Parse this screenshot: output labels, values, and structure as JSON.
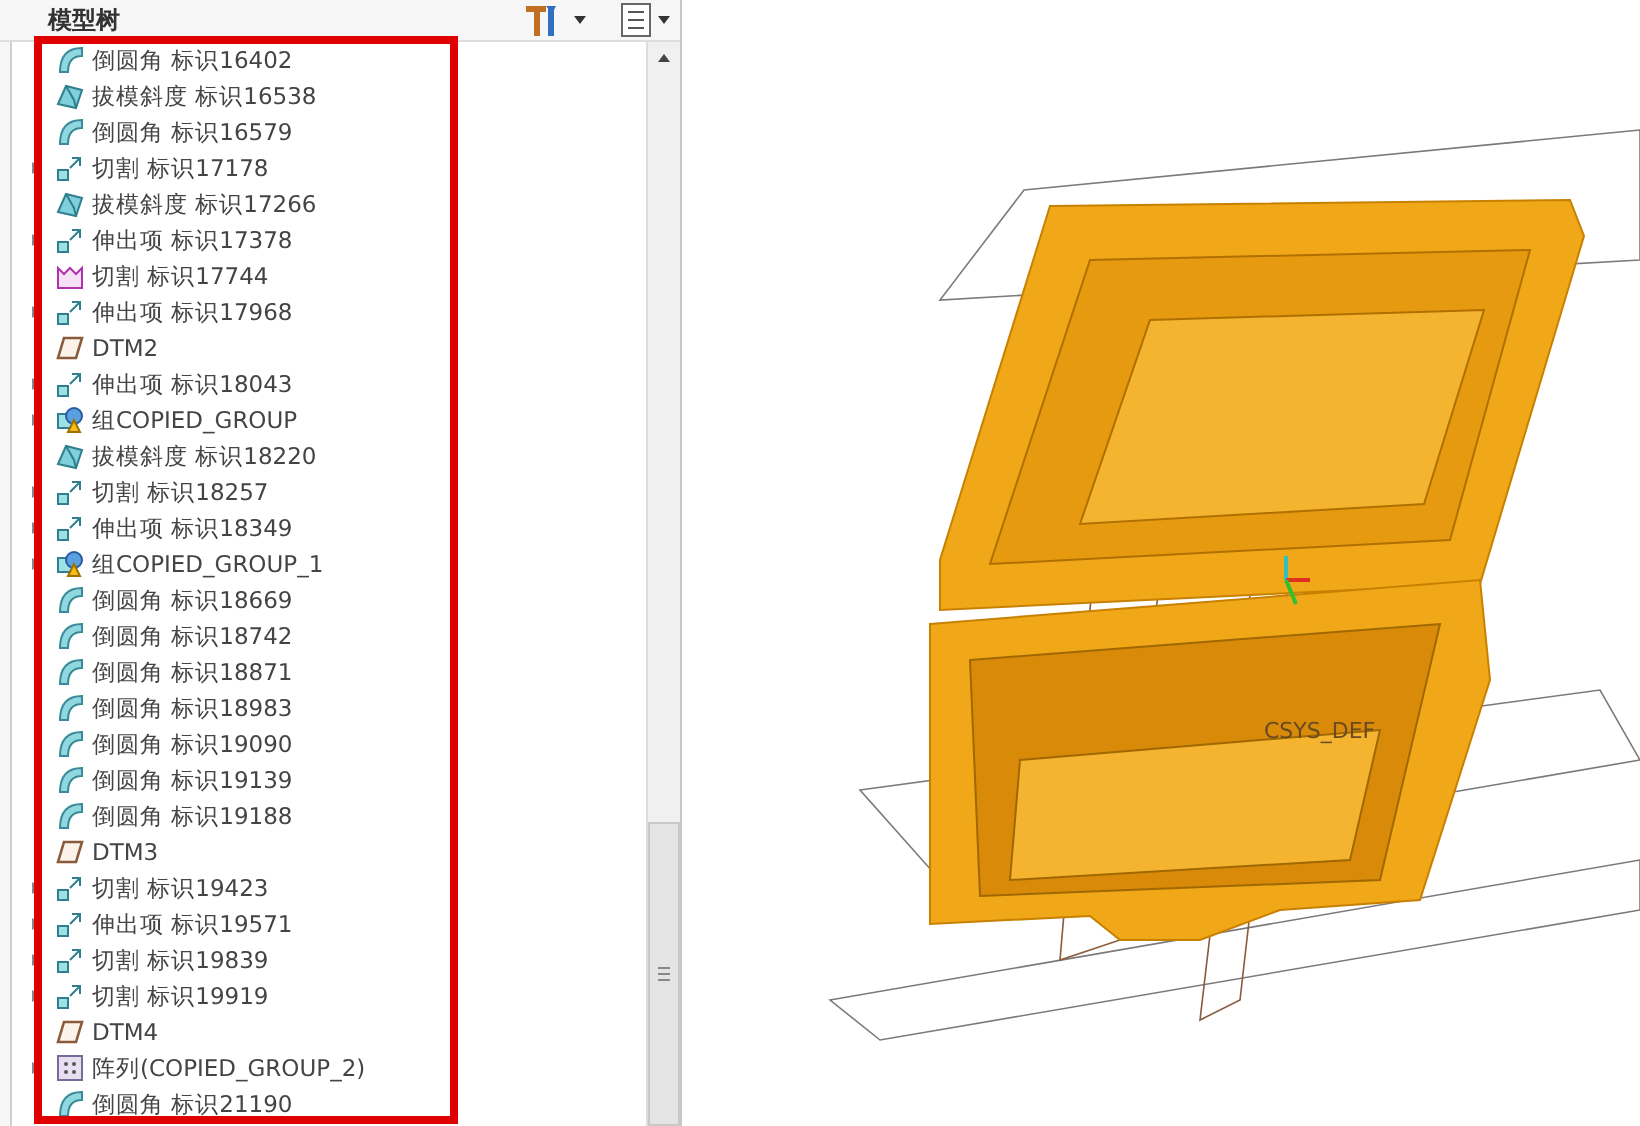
{
  "panel": {
    "title": "模型树"
  },
  "tree": {
    "items": [
      {
        "kind": "round",
        "label": "倒圆角 标识16402",
        "expandable": false
      },
      {
        "kind": "draft",
        "label": "拔模斜度 标识16538",
        "expandable": false
      },
      {
        "kind": "round",
        "label": "倒圆角 标识16579",
        "expandable": false
      },
      {
        "kind": "extrude",
        "label": "切割 标识17178",
        "expandable": true
      },
      {
        "kind": "draft",
        "label": "拔模斜度 标识17266",
        "expandable": false
      },
      {
        "kind": "extrude",
        "label": "伸出项 标识17378",
        "expandable": true
      },
      {
        "kind": "revolve",
        "label": "切割 标识17744",
        "expandable": false
      },
      {
        "kind": "extrude",
        "label": "伸出项 标识17968",
        "expandable": true
      },
      {
        "kind": "datum",
        "label": "DTM2",
        "expandable": false
      },
      {
        "kind": "extrude",
        "label": "伸出项 标识18043",
        "expandable": true
      },
      {
        "kind": "group",
        "label": "组COPIED_GROUP",
        "expandable": true
      },
      {
        "kind": "draft",
        "label": "拔模斜度 标识18220",
        "expandable": false
      },
      {
        "kind": "extrude",
        "label": "切割 标识18257",
        "expandable": true
      },
      {
        "kind": "extrude",
        "label": "伸出项 标识18349",
        "expandable": true
      },
      {
        "kind": "group",
        "label": "组COPIED_GROUP_1",
        "expandable": true
      },
      {
        "kind": "round",
        "label": "倒圆角 标识18669",
        "expandable": false
      },
      {
        "kind": "round",
        "label": "倒圆角 标识18742",
        "expandable": false
      },
      {
        "kind": "round",
        "label": "倒圆角 标识18871",
        "expandable": false
      },
      {
        "kind": "round",
        "label": "倒圆角 标识18983",
        "expandable": false
      },
      {
        "kind": "round",
        "label": "倒圆角 标识19090",
        "expandable": false
      },
      {
        "kind": "round",
        "label": "倒圆角 标识19139",
        "expandable": false
      },
      {
        "kind": "round",
        "label": "倒圆角 标识19188",
        "expandable": false
      },
      {
        "kind": "datum",
        "label": "DTM3",
        "expandable": false
      },
      {
        "kind": "extrude",
        "label": "切割 标识19423",
        "expandable": true
      },
      {
        "kind": "extrude",
        "label": "伸出项 标识19571",
        "expandable": true
      },
      {
        "kind": "extrude",
        "label": "切割 标识19839",
        "expandable": true
      },
      {
        "kind": "extrude",
        "label": "切割 标识19919",
        "expandable": true
      },
      {
        "kind": "datum",
        "label": "DTM4",
        "expandable": false
      },
      {
        "kind": "pattern",
        "label": "阵列(COPIED_GROUP_2)",
        "expandable": true
      },
      {
        "kind": "round",
        "label": "倒圆角 标识21190",
        "expandable": false
      }
    ]
  },
  "viewport": {
    "csys_label": "CSYS_DEF"
  }
}
